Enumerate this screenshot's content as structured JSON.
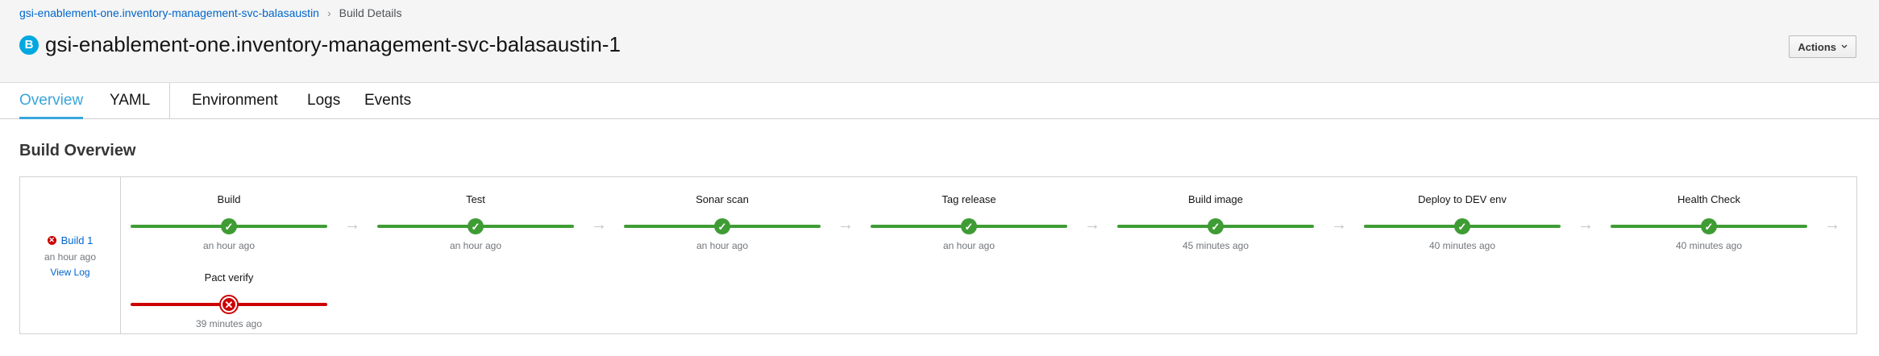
{
  "breadcrumb": {
    "parent": "gsi-enablement-one.inventory-management-svc-balasaustin",
    "current": "Build Details"
  },
  "header": {
    "badge": "B",
    "title": "gsi-enablement-one.inventory-management-svc-balasaustin-1",
    "actions_label": "Actions"
  },
  "tabs": [
    {
      "label": "Overview",
      "active": true
    },
    {
      "label": "YAML",
      "active": false
    },
    {
      "label": "Environment",
      "active": false
    },
    {
      "label": "Logs",
      "active": false
    },
    {
      "label": "Events",
      "active": false
    }
  ],
  "overview": {
    "title": "Build Overview",
    "build": {
      "label": "Build 1",
      "status": "failed",
      "time": "an hour ago",
      "view_log": "View Log"
    },
    "stages": [
      {
        "name": "Build",
        "status": "success",
        "time": "an hour ago"
      },
      {
        "name": "Test",
        "status": "success",
        "time": "an hour ago"
      },
      {
        "name": "Sonar scan",
        "status": "success",
        "time": "an hour ago"
      },
      {
        "name": "Tag release",
        "status": "success",
        "time": "an hour ago"
      },
      {
        "name": "Build image",
        "status": "success",
        "time": "45 minutes ago"
      },
      {
        "name": "Deploy to DEV env",
        "status": "success",
        "time": "40 minutes ago"
      },
      {
        "name": "Health Check",
        "status": "success",
        "time": "40 minutes ago"
      },
      {
        "name": "Pact verify",
        "status": "failed",
        "time": "39 minutes ago"
      }
    ]
  },
  "colors": {
    "success": "#3f9c35",
    "failed": "#cc0000",
    "accent": "#39a5dc",
    "link": "#0066cc"
  }
}
